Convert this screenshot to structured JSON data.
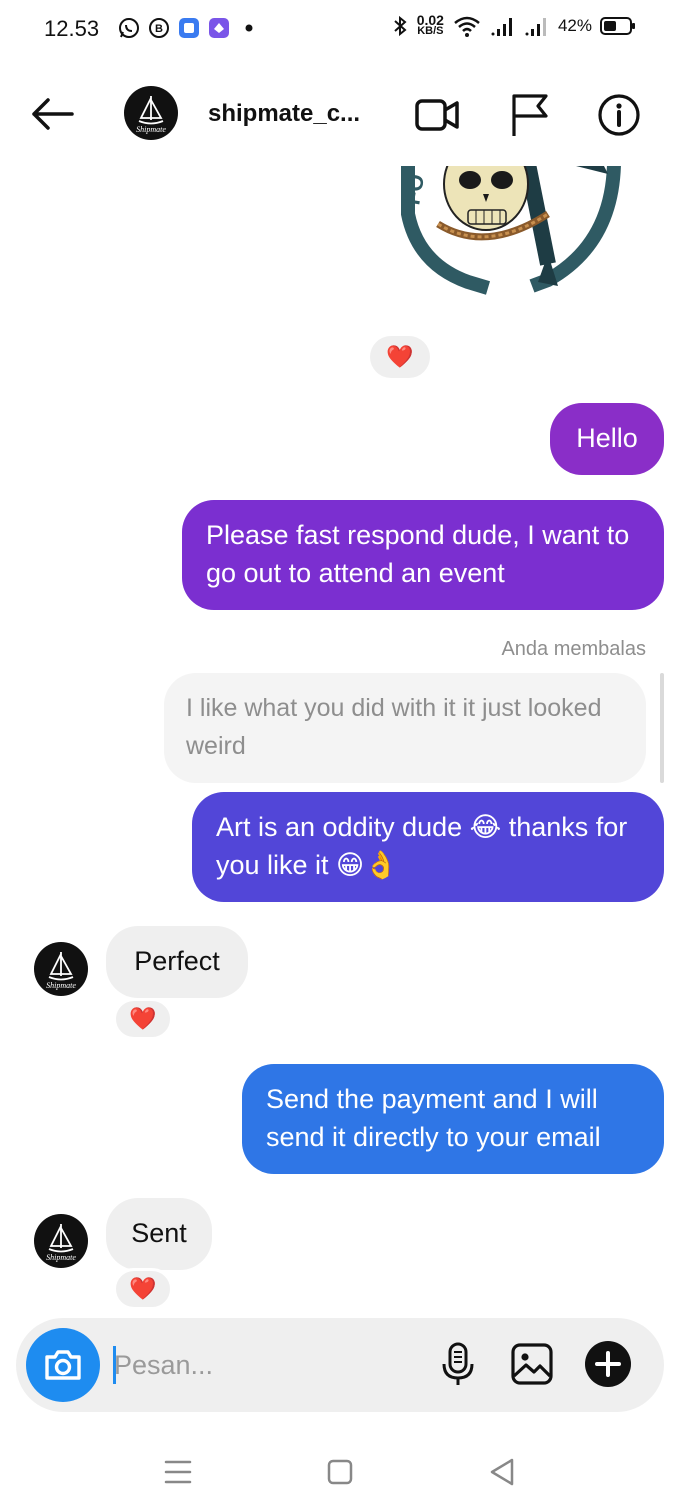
{
  "status_bar": {
    "time": "12.53",
    "net_speed_value": "0.02",
    "net_speed_unit": "KB/S",
    "battery": "42%"
  },
  "header": {
    "name": "shipmate_c...",
    "avatar_text": "Shipmate"
  },
  "colors": {
    "purple": "#7f2fcf",
    "indigo": "#5a46d8",
    "blue": "#2e77e8",
    "incoming_bg": "#efefef",
    "camera": "#1e8cf0"
  },
  "messages": {
    "hello": "Hello",
    "please": "Please fast respond dude, I want to go out to attend an event",
    "reply_label": "Anda membalas",
    "reply_quote": "I like what you did with it it just looked weird",
    "art": "Art is an oddity dude 😂 thanks for you like it 😁👌",
    "perfect": "Perfect",
    "payment": "Send the payment and I will send it directly to your email",
    "sent": "Sent"
  },
  "reactions": {
    "heart": "❤️"
  },
  "composer": {
    "placeholder": "Pesan..."
  },
  "icons": [
    "back-arrow-icon",
    "video-call-icon",
    "flag-icon",
    "info-icon",
    "send-icon",
    "camera-icon",
    "microphone-icon",
    "gallery-icon",
    "plus-icon",
    "menu-icon",
    "home-icon",
    "back-triangle-icon"
  ]
}
